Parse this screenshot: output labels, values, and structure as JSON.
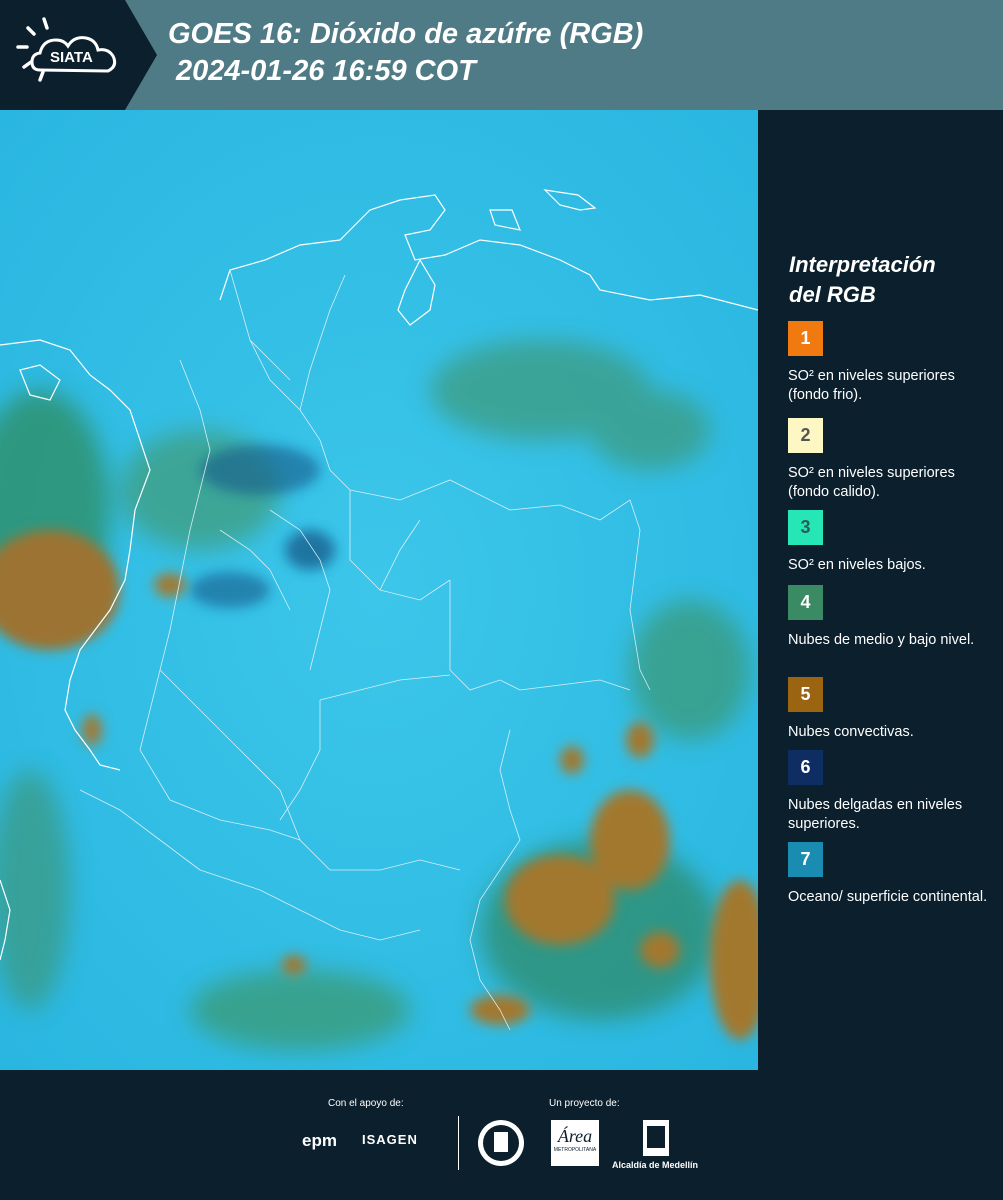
{
  "header": {
    "logo_text": "SIATA",
    "title_line1": "GOES 16: Dióxido de azúfre (RGB)",
    "title_line2": "2024-01-26 16:59 COT"
  },
  "legend": {
    "title_line1": "Interpretación",
    "title_line2": "del RGB",
    "items": [
      {
        "number": "1",
        "color": "#f07a10",
        "text_color": "#ffffff",
        "label": "SO² en niveles superiores (fondo frio)."
      },
      {
        "number": "2",
        "color": "#fdf7c4",
        "text_color": "#555555",
        "label": "SO² en niveles superiores (fondo calido)."
      },
      {
        "number": "3",
        "color": "#27e6b6",
        "text_color": "#2b5f55",
        "label": "SO² en niveles bajos."
      },
      {
        "number": "4",
        "color": "#3a8a63",
        "text_color": "#ffffff",
        "label": "Nubes de medio y bajo nivel."
      },
      {
        "number": "5",
        "color": "#9a6410",
        "text_color": "#ffffff",
        "label": "Nubes convectivas."
      },
      {
        "number": "6",
        "color": "#0e2d63",
        "text_color": "#ffffff",
        "label": "Nubes delgadas en niveles superiores."
      },
      {
        "number": "7",
        "color": "#1a8cb2",
        "text_color": "#ffffff",
        "label": "Oceano/ superficie continental."
      }
    ]
  },
  "footer": {
    "support_label": "Con el apoyo de:",
    "project_label": "Un proyecto de:",
    "sponsor_epm": "epm",
    "sponsor_isagen": "ISAGEN",
    "partner_area": "Área",
    "partner_area_sub": "METROPOLITANA",
    "partner_alcaldia": "Alcaldía de Medellín"
  }
}
